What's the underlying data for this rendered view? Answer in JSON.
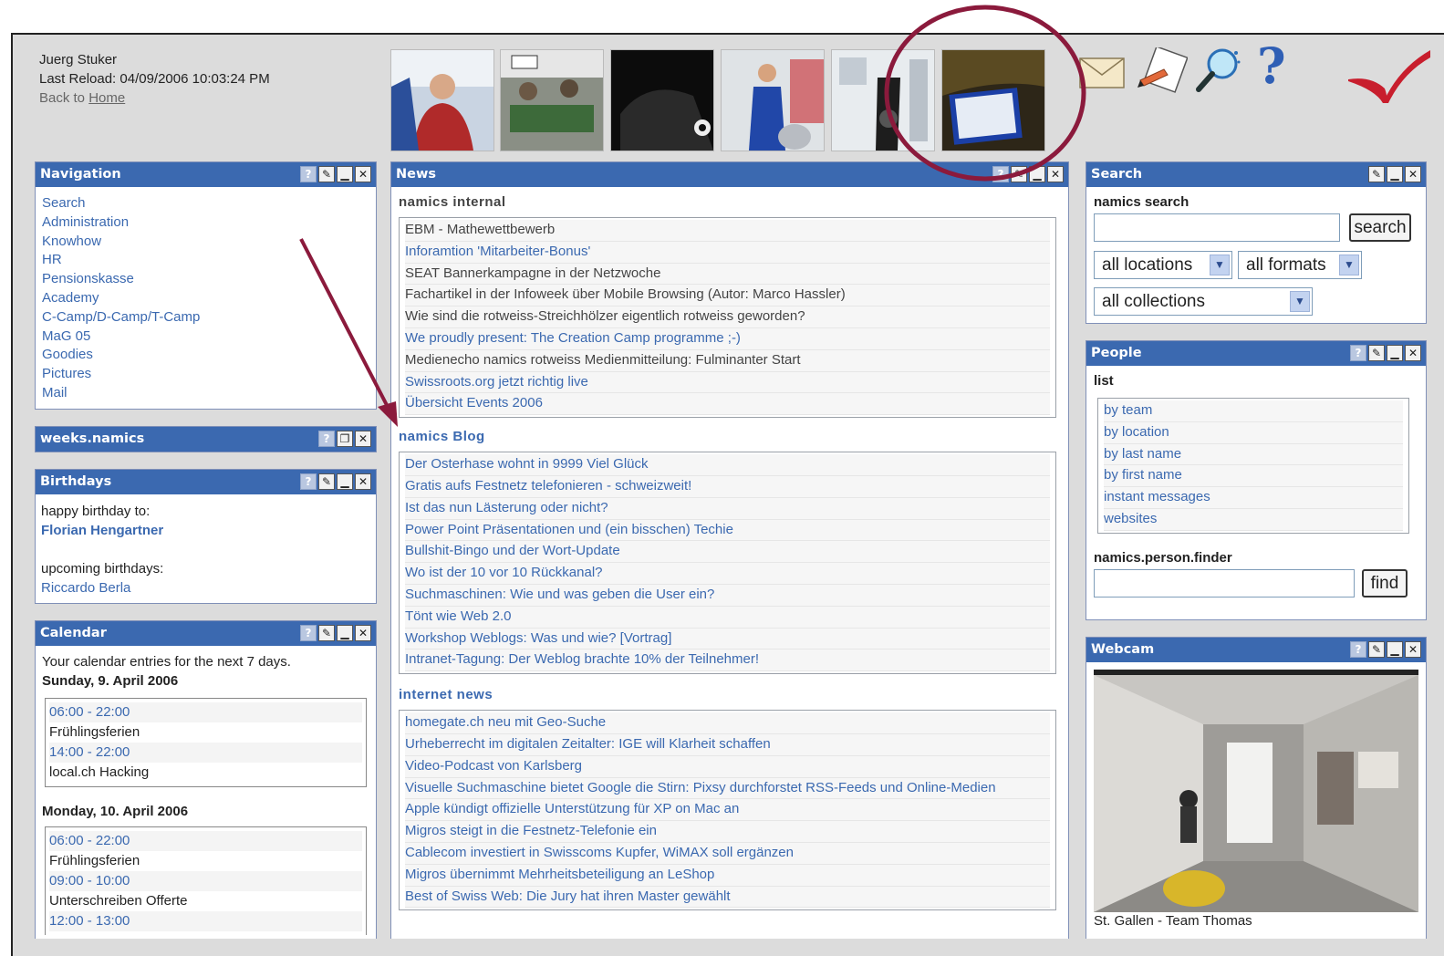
{
  "header": {
    "user_name": "Juerg Stuker",
    "last_reload": "Last Reload: 04/09/2006 10:03:24 PM",
    "back_link_pre": "Back to ",
    "back_link_word": "Home"
  },
  "navigation": {
    "title": "Navigation",
    "items": [
      "Search",
      "Administration",
      "Knowhow",
      "HR",
      "Pensionskasse",
      "Academy",
      "C-Camp/D-Camp/T-Camp",
      "MaG 05",
      "Goodies",
      "Pictures",
      "Mail"
    ]
  },
  "weeks": {
    "title": "weeks.namics"
  },
  "birthdays": {
    "title": "Birthdays",
    "happy_label": "happy birthday to:",
    "happy_name": "Florian Hengartner",
    "upcoming_label": "upcoming birthdays:",
    "upcoming_name": "Riccardo Berla"
  },
  "calendar": {
    "title": "Calendar",
    "intro": "Your calendar entries for the next 7 days.",
    "days": [
      {
        "date": "Sunday, 9. April 2006",
        "entries": [
          {
            "time": "06:00 - 22:00",
            "title": "Frühlingsferien"
          },
          {
            "time": "14:00 - 22:00",
            "title": "local.ch Hacking"
          }
        ]
      },
      {
        "date": "Monday, 10. April 2006",
        "entries": [
          {
            "time": "06:00 - 22:00",
            "title": "Frühlingsferien"
          },
          {
            "time": "09:00 - 10:00",
            "title": "Unterschreiben Offerte"
          },
          {
            "time": "12:00 - 13:00",
            "title": ""
          }
        ]
      }
    ]
  },
  "news": {
    "title": "News",
    "sections": [
      {
        "title": "namics internal",
        "items": [
          {
            "text": "EBM - Mathewettbewerb",
            "color": "gray"
          },
          {
            "text": "Inforamtion 'Mitarbeiter-Bonus'",
            "color": "blue"
          },
          {
            "text": "SEAT Bannerkampagne in der Netzwoche",
            "color": "gray"
          },
          {
            "text": "Fachartikel in der Infoweek über Mobile Browsing (Autor: Marco Hassler)",
            "color": "gray"
          },
          {
            "text": "Wie sind die rotweiss-Streichhölzer eigentlich rotweiss geworden?",
            "color": "gray"
          },
          {
            "text": "We proudly present: The Creation Camp programme ;-)",
            "color": "blue"
          },
          {
            "text": "Medienecho namics rotweiss Medienmitteilung: Fulminanter Start",
            "color": "gray"
          },
          {
            "text": "Swissroots.org jetzt richtig live",
            "color": "blue"
          },
          {
            "text": "Übersicht Events 2006",
            "color": "blue"
          }
        ]
      },
      {
        "title": "namics Blog",
        "items": [
          {
            "text": "Der Osterhase wohnt in 9999 Viel Glück",
            "color": "blue"
          },
          {
            "text": "Gratis aufs Festnetz telefonieren - schweizweit!",
            "color": "blue"
          },
          {
            "text": "Ist das nun Lästerung oder nicht?",
            "color": "blue"
          },
          {
            "text": "Power Point Präsentationen und (ein bisschen) Techie",
            "color": "blue"
          },
          {
            "text": "Bullshit-Bingo und der Wort-Update",
            "color": "blue"
          },
          {
            "text": "Wo ist der 10 vor 10 Rückkanal?",
            "color": "blue"
          },
          {
            "text": "Suchmaschinen: Wie und was geben die User ein?",
            "color": "blue"
          },
          {
            "text": "Tönt wie Web 2.0",
            "color": "blue"
          },
          {
            "text": "Workshop Weblogs: Was und wie? [Vortrag]",
            "color": "blue"
          },
          {
            "text": "Intranet-Tagung: Der Weblog brachte 10% der Teilnehmer!",
            "color": "blue"
          }
        ]
      },
      {
        "title": "internet news",
        "items": [
          {
            "text": "homegate.ch neu mit Geo-Suche",
            "color": "blue"
          },
          {
            "text": "Urheberrecht im digitalen Zeitalter: IGE will Klarheit schaffen",
            "color": "blue"
          },
          {
            "text": "Video-Podcast von Karlsberg",
            "color": "blue"
          },
          {
            "text": "Visuelle Suchmaschine bietet Google die Stirn: Pixsy durchforstet RSS-Feeds und Online-Medien",
            "color": "blue"
          },
          {
            "text": "Apple kündigt offizielle Unterstützung für XP on Mac an",
            "color": "blue"
          },
          {
            "text": "Migros steigt in die Festnetz-Telefonie ein",
            "color": "blue"
          },
          {
            "text": "Cablecom investiert in Swisscoms Kupfer, WiMAX soll ergänzen",
            "color": "blue"
          },
          {
            "text": "Migros übernimmt Mehrheitsbeteiligung an LeShop",
            "color": "blue"
          },
          {
            "text": "Best of Swiss Web: Die Jury hat ihren Master gewählt",
            "color": "blue"
          }
        ]
      }
    ]
  },
  "search": {
    "title": "Search",
    "label": "namics search",
    "input_value": "",
    "button": "search",
    "locations": "all locations",
    "formats": "all formats",
    "collections": "all collections"
  },
  "people": {
    "title": "People",
    "list_label": "list",
    "items": [
      "by team",
      "by location",
      "by last name",
      "by first name",
      "instant messages",
      "websites"
    ],
    "finder_label": "namics.person.finder",
    "finder_value": "",
    "find_button": "find"
  },
  "webcam": {
    "title": "Webcam",
    "overlay_text": "",
    "caption": "St. Gallen - Team Thomas"
  },
  "icons": [
    "mail-icon",
    "notepad-icon",
    "search-magnifier-icon",
    "help-question-icon",
    "logo-check-icon"
  ],
  "colors": {
    "title_bar": "#3b69b0",
    "link": "#3b69b0",
    "annotation": "#8b1a3c",
    "background": "#dcdcdc"
  }
}
